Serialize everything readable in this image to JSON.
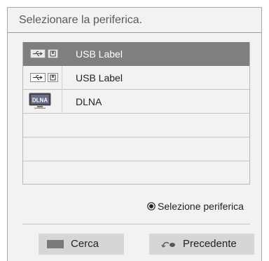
{
  "dialog": {
    "title": "Selezionare la periferica."
  },
  "devices": [
    {
      "label": "USB Label",
      "icon": "usb-icon",
      "selected": true
    },
    {
      "label": "USB Label",
      "icon": "usb-icon",
      "selected": false
    },
    {
      "label": "DLNA",
      "icon": "dlna-icon",
      "selected": false,
      "icon_text": "DLNA"
    },
    {
      "label": "",
      "icon": "",
      "selected": false
    },
    {
      "label": "",
      "icon": "",
      "selected": false
    }
  ],
  "hint": {
    "icon": "radio-selected-icon",
    "label": "Selezione periferica"
  },
  "buttons": {
    "search_label": "Cerca",
    "search_icon": "gray-key-icon",
    "back_label": "Precedente",
    "back_icon": "return-icon"
  },
  "colors": {
    "selected_row": "#7f7f7f",
    "panel_background": "#f2f2f2",
    "button_background": "#d6d6d6"
  }
}
